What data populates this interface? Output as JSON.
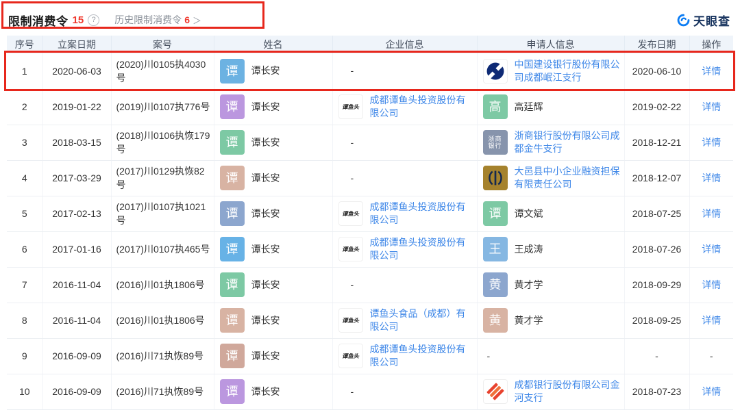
{
  "header": {
    "title": "限制消费令",
    "count": "15",
    "help_glyph": "?",
    "history_label": "历史限制消费令",
    "history_count": "6",
    "history_arrow": "＞",
    "brand": "天眼查"
  },
  "icons": {
    "tanyutou_label": "谭鱼头",
    "zheshang_label_line1": "浙商",
    "zheshang_label_line2": "银行"
  },
  "colors": {
    "link_blue": "#3E87E8",
    "count_red": "#F0392E",
    "annotation_red": "#E7271C",
    "header_bg": "#EFF4FA",
    "brand_blue": "#0B7CF4"
  },
  "table": {
    "columns": [
      "序号",
      "立案日期",
      "案号",
      "姓名",
      "企业信息",
      "申请人信息",
      "发布日期",
      "操作"
    ],
    "rows": [
      {
        "no": "1",
        "date": "2020-06-03",
        "case": "(2020)川0105执4030号",
        "person": {
          "char": "谭",
          "color": "#6CB2E2",
          "name": "谭长安"
        },
        "company": {
          "kind": "none",
          "text": "-"
        },
        "applicant": {
          "kind": "company",
          "logo": "ccb",
          "name": "中国建设银行股份有限公司成都岷江支行"
        },
        "pub": "2020-06-10",
        "action": "详情",
        "action_is_link": true,
        "boxed": true
      },
      {
        "no": "2",
        "date": "2019-01-22",
        "case": "(2019)川0107执776号",
        "person": {
          "char": "谭",
          "color": "#BB97DF",
          "name": "谭长安"
        },
        "company": {
          "kind": "company",
          "logo": "tanyutou",
          "name": "成都谭鱼头投资股份有限公司"
        },
        "applicant": {
          "kind": "person",
          "char": "高",
          "color": "#7DC9A4",
          "name": "高廷辉"
        },
        "pub": "2019-02-22",
        "action": "详情",
        "action_is_link": true
      },
      {
        "no": "3",
        "date": "2018-03-15",
        "case": "(2018)川0106执恢179号",
        "person": {
          "char": "谭",
          "color": "#7DC9A4",
          "name": "谭长安"
        },
        "company": {
          "kind": "none",
          "text": "-"
        },
        "applicant": {
          "kind": "company",
          "logo": "zheshang",
          "name": "浙商银行股份有限公司成都金牛支行"
        },
        "pub": "2018-12-21",
        "action": "详情",
        "action_is_link": true
      },
      {
        "no": "4",
        "date": "2017-03-29",
        "case": "(2017)川0129执恢82号",
        "person": {
          "char": "谭",
          "color": "#D8B3A3",
          "name": "谭长安"
        },
        "company": {
          "kind": "none",
          "text": "-"
        },
        "applicant": {
          "kind": "company",
          "logo": "dayi",
          "name": "大邑县中小企业融资担保有限责任公司"
        },
        "pub": "2018-12-07",
        "action": "详情",
        "action_is_link": true
      },
      {
        "no": "5",
        "date": "2017-02-13",
        "case": "(2017)川0107执1021号",
        "person": {
          "char": "谭",
          "color": "#8CA6CE",
          "name": "谭长安"
        },
        "company": {
          "kind": "company",
          "logo": "tanyutou",
          "name": "成都谭鱼头投资股份有限公司"
        },
        "applicant": {
          "kind": "person",
          "char": "谭",
          "color": "#7DC9A4",
          "name": "谭文斌"
        },
        "pub": "2018-07-25",
        "action": "详情",
        "action_is_link": true
      },
      {
        "no": "6",
        "date": "2017-01-16",
        "case": "(2017)川0107执465号",
        "person": {
          "char": "谭",
          "color": "#67B2E6",
          "name": "谭长安"
        },
        "company": {
          "kind": "company",
          "logo": "tanyutou",
          "name": "成都谭鱼头投资股份有限公司"
        },
        "applicant": {
          "kind": "person",
          "char": "王",
          "color": "#85B7E2",
          "name": "王成涛"
        },
        "pub": "2018-07-26",
        "action": "详情",
        "action_is_link": true
      },
      {
        "no": "7",
        "date": "2016-11-04",
        "case": "(2016)川01执1806号",
        "person": {
          "char": "谭",
          "color": "#7DC9A4",
          "name": "谭长安"
        },
        "company": {
          "kind": "none",
          "text": "-"
        },
        "applicant": {
          "kind": "person",
          "char": "黄",
          "color": "#8CA6CE",
          "name": "黄才学"
        },
        "pub": "2018-09-29",
        "action": "详情",
        "action_is_link": true
      },
      {
        "no": "8",
        "date": "2016-11-04",
        "case": "(2016)川01执1806号",
        "person": {
          "char": "谭",
          "color": "#D8B3A3",
          "name": "谭长安"
        },
        "company": {
          "kind": "company",
          "logo": "tanyutou",
          "name": "谭鱼头食品（成都）有限公司"
        },
        "applicant": {
          "kind": "person",
          "char": "黄",
          "color": "#D8B3A3",
          "name": "黄才学"
        },
        "pub": "2018-09-25",
        "action": "详情",
        "action_is_link": true
      },
      {
        "no": "9",
        "date": "2016-09-09",
        "case": "(2016)川71执恢89号",
        "person": {
          "char": "谭",
          "color": "#D0A89B",
          "name": "谭长安"
        },
        "company": {
          "kind": "company",
          "logo": "tanyutou",
          "name": "成都谭鱼头投资股份有限公司"
        },
        "applicant": {
          "kind": "none",
          "text": "-"
        },
        "pub": "-",
        "action": "-",
        "action_is_link": false
      },
      {
        "no": "10",
        "date": "2016-09-09",
        "case": "(2016)川71执恢89号",
        "person": {
          "char": "谭",
          "color": "#BB97DF",
          "name": "谭长安"
        },
        "company": {
          "kind": "none",
          "text": "-"
        },
        "applicant": {
          "kind": "company",
          "logo": "chengdu",
          "name": "成都银行股份有限公司金河支行"
        },
        "pub": "2018-07-23",
        "action": "详情",
        "action_is_link": true
      }
    ]
  }
}
